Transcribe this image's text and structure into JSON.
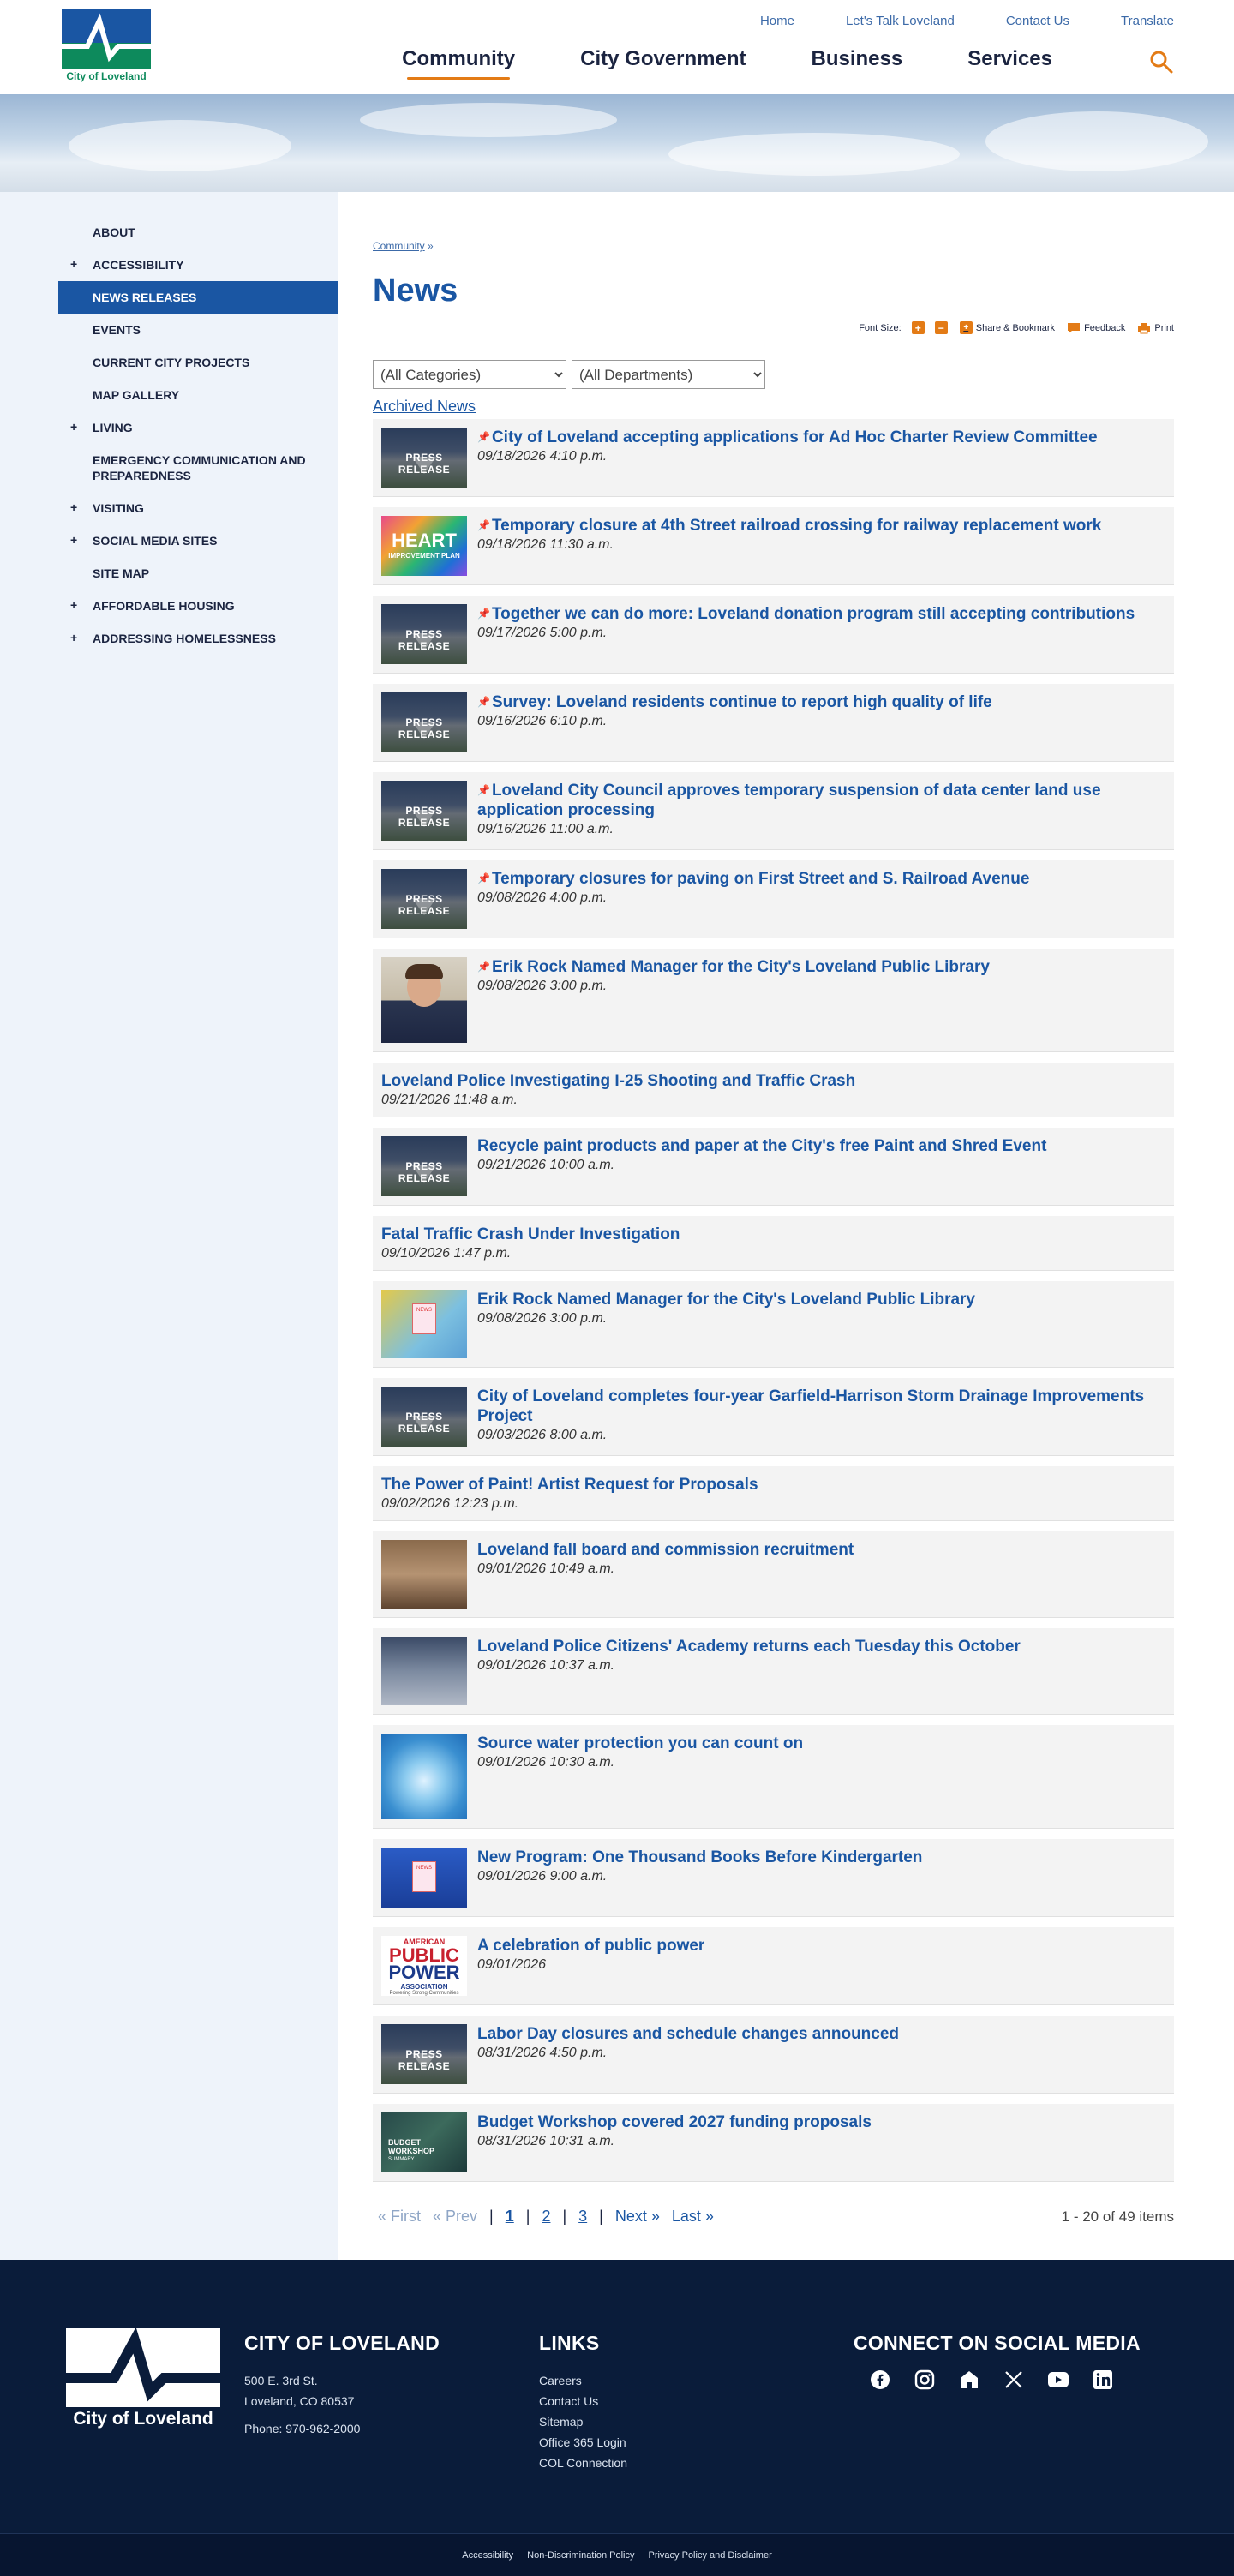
{
  "header": {
    "logo_text": "City of Loveland",
    "util_nav": [
      "Home",
      "Let's Talk Loveland",
      "Contact Us",
      "Translate"
    ],
    "main_nav": [
      "Community",
      "City Government",
      "Business",
      "Services"
    ],
    "active_nav": "Community"
  },
  "sidebar": {
    "items": [
      {
        "label": "About",
        "expandable": false
      },
      {
        "label": "Accessibility",
        "expandable": true
      },
      {
        "label": "News Releases",
        "expandable": false,
        "active": true
      },
      {
        "label": "Events",
        "expandable": false
      },
      {
        "label": "Current City Projects",
        "expandable": false
      },
      {
        "label": "Map Gallery",
        "expandable": false
      },
      {
        "label": "Living",
        "expandable": true
      },
      {
        "label": "Emergency Communication and Preparedness",
        "expandable": false
      },
      {
        "label": "Visiting",
        "expandable": true
      },
      {
        "label": "Social Media Sites",
        "expandable": true
      },
      {
        "label": "Site Map",
        "expandable": false
      },
      {
        "label": "Affordable Housing",
        "expandable": true
      },
      {
        "label": "Addressing Homelessness",
        "expandable": true
      }
    ]
  },
  "breadcrumb": {
    "crumb": "Community",
    "sep": "»"
  },
  "page_title": "News",
  "tools": {
    "font_size_label": "Font Size:",
    "increase": "+",
    "decrease": "−",
    "share": "Share & Bookmark",
    "feedback": "Feedback",
    "print": "Print"
  },
  "filters": {
    "categories": "(All Categories)",
    "departments": "(All Departments)"
  },
  "archived_link": "Archived News",
  "news": [
    {
      "title": "City of Loveland accepting applications for Ad Hoc Charter Review Committee",
      "date": "09/18/2026 4:10 p.m.",
      "thumb": "press",
      "pinned": true
    },
    {
      "title": "Temporary closure at 4th Street railroad crossing for railway replacement work",
      "date": "09/18/2026 11:30 a.m.",
      "thumb": "heart",
      "pinned": true
    },
    {
      "title": "Together we can do more: Loveland donation program still accepting contributions",
      "date": "09/17/2026 5:00 p.m.",
      "thumb": "press",
      "pinned": true
    },
    {
      "title": "Survey: Loveland residents continue to report high quality of life",
      "date": "09/16/2026 6:10 p.m.",
      "thumb": "press",
      "pinned": true
    },
    {
      "title": "Loveland City Council approves temporary suspension of data center land use application processing",
      "date": "09/16/2026 11:00 a.m.",
      "thumb": "press",
      "pinned": true
    },
    {
      "title": "Temporary closures for paving on First Street and S. Railroad Avenue",
      "date": "09/08/2026 4:00 p.m.",
      "thumb": "press",
      "pinned": true
    },
    {
      "title": "Erik Rock Named Manager for the City's Loveland Public Library",
      "date": "09/08/2026 3:00 p.m.",
      "thumb": "person",
      "pinned": true
    },
    {
      "title": "Loveland Police Investigating I-25 Shooting and Traffic Crash",
      "date": "09/21/2026 11:48 a.m.",
      "thumb": "",
      "pinned": false
    },
    {
      "title": "Recycle paint products and paper at the City's free Paint and Shred Event",
      "date": "09/21/2026 10:00 a.m.",
      "thumb": "press",
      "pinned": false
    },
    {
      "title": "Fatal Traffic Crash Under Investigation",
      "date": "09/10/2026 1:47 p.m.",
      "thumb": "",
      "pinned": false
    },
    {
      "title": "Erik Rock Named Manager for the City's Loveland Public Library",
      "date": "09/08/2026 3:00 p.m.",
      "thumb": "books",
      "pinned": false
    },
    {
      "title": "City of Loveland completes four-year Garfield-Harrison Storm Drainage Improvements Project",
      "date": "09/03/2026 8:00 a.m.",
      "thumb": "press",
      "pinned": false
    },
    {
      "title": "The Power of Paint! Artist Request for Proposals",
      "date": "09/02/2026 12:23 p.m.",
      "thumb": "",
      "pinned": false
    },
    {
      "title": "Loveland fall board and commission recruitment",
      "date": "09/01/2026 10:49 a.m.",
      "thumb": "room",
      "pinned": false
    },
    {
      "title": "Loveland Police Citizens' Academy returns each Tuesday this October",
      "date": "09/01/2026 10:37 a.m.",
      "thumb": "academy",
      "pinned": false
    },
    {
      "title": "Source water protection you can count on",
      "date": "09/01/2026 10:30 a.m.",
      "thumb": "water",
      "pinned": false
    },
    {
      "title": "New Program: One Thousand Books Before Kindergarten",
      "date": "09/01/2026 9:00 a.m.",
      "thumb": "booksblue",
      "pinned": false
    },
    {
      "title": "A celebration of public power",
      "date": "09/01/2026",
      "thumb": "power",
      "pinned": false
    },
    {
      "title": "Labor Day closures and schedule changes announced",
      "date": "08/31/2026 4:50 p.m.",
      "thumb": "press",
      "pinned": false
    },
    {
      "title": "Budget Workshop covered 2027 funding proposals",
      "date": "08/31/2026 10:31 a.m.",
      "thumb": "budget",
      "pinned": false
    }
  ],
  "thumb_text": {
    "press": "PRESS RELEASE",
    "heart_1": "HEART",
    "heart_2": "IMPROVEMENT PLAN",
    "books": "NEWS",
    "power_1": "AMERICAN",
    "power_2": "PUBLIC",
    "power_3": "POWER",
    "power_4": "ASSOCIATION",
    "power_5": "Powering Strong Communities",
    "budget_1": "BUDGET WORKSHOP",
    "budget_2": "SUMMARY"
  },
  "pagination": {
    "first": "« First",
    "prev": "« Prev",
    "pages": [
      "1",
      "2",
      "3"
    ],
    "current": "1",
    "next": "Next »",
    "last": "Last »",
    "summary": "1 - 20 of 49 items"
  },
  "footer": {
    "logo_text": "City of Loveland",
    "city_heading": "CITY OF LOVELAND",
    "address_1": "500 E. 3rd St.",
    "address_2": "Loveland, CO 80537",
    "phone": "Phone: 970-962-2000",
    "links_heading": "LINKS",
    "links": [
      "Careers",
      "Contact Us",
      "Sitemap",
      "Office 365 Login",
      "COL Connection"
    ],
    "social_heading": "CONNECT ON SOCIAL MEDIA",
    "social": [
      "facebook-icon",
      "instagram-icon",
      "nextdoor-icon",
      "x-icon",
      "youtube-icon",
      "linkedin-icon"
    ],
    "bottom_links": [
      "Accessibility",
      "Non-Discrimination Policy",
      "Privacy Policy and Disclaimer"
    ]
  },
  "colors": {
    "brand_blue": "#1a56a3",
    "accent_orange": "#e37b16",
    "footer_navy": "#0a1c3a",
    "logo_green": "#0d8a5c"
  }
}
